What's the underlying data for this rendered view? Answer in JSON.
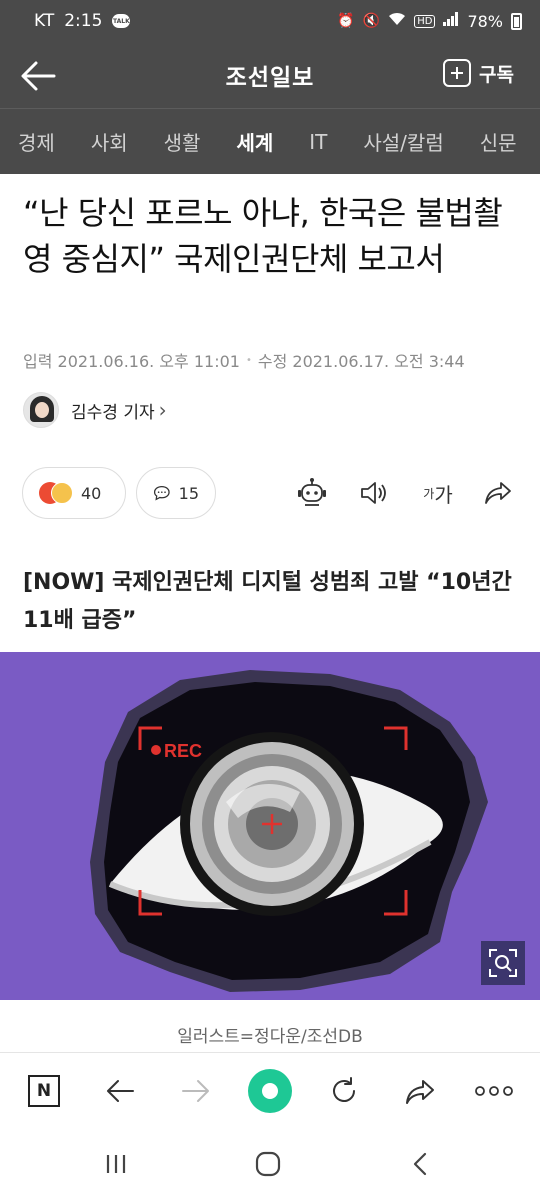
{
  "status_bar": {
    "carrier": "KT",
    "time": "2:15",
    "talk_badge": "TALK",
    "battery": "78%"
  },
  "header": {
    "title": "조선일보",
    "subscribe_label": "구독"
  },
  "categories": [
    "경제",
    "사회",
    "생활",
    "세계",
    "IT",
    "사설/칼럼",
    "신문"
  ],
  "active_category": "세계",
  "article": {
    "headline": "“난 당신 포르노 아냐, 한국은 불법촬영 중심지” 국제인권단체 보고서",
    "published": "입력 2021.06.16. 오후 11:01",
    "updated": "수정 2021.06.17. 오전 3:44",
    "author": "김수경 기자",
    "author_chevron": "›",
    "reaction_count": "40",
    "comment_count": "15",
    "font_label_small": "가",
    "font_label_large": "가",
    "subheading": "[NOW] 국제인권단체 디지털 성범죄 고발 “10년간 11배 급증”",
    "image_rec_label": "REC",
    "image_caption": "일러스트=정다운/조선DB"
  },
  "colors": {
    "header_bg": "#4a4a4a",
    "illustration_bg": "#7a5bc4",
    "accent_green": "#1ec895",
    "rec_red": "#e0322e"
  },
  "icons": {
    "back": "arrow-left-icon",
    "subscribe": "plus-box-icon",
    "tts_robot": "robot-icon",
    "speaker": "speaker-icon",
    "share": "share-icon",
    "zoom": "zoom-scan-icon"
  }
}
